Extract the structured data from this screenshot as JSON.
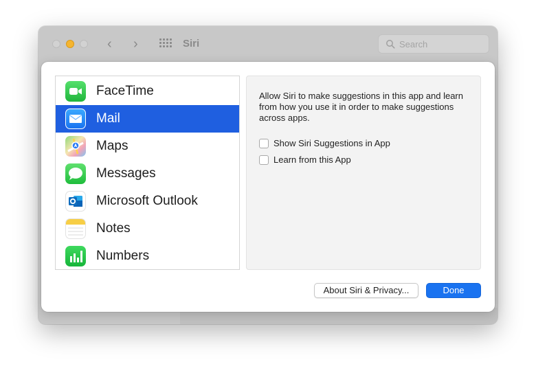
{
  "window": {
    "title": "Siri",
    "search_placeholder": "Search"
  },
  "apps": [
    {
      "label": "FaceTime",
      "icon": "facetime-icon",
      "selected": false
    },
    {
      "label": "Mail",
      "icon": "mail-icon",
      "selected": true
    },
    {
      "label": "Maps",
      "icon": "maps-icon",
      "selected": false
    },
    {
      "label": "Messages",
      "icon": "messages-icon",
      "selected": false
    },
    {
      "label": "Microsoft Outlook",
      "icon": "outlook-icon",
      "selected": false
    },
    {
      "label": "Notes",
      "icon": "notes-icon",
      "selected": false
    },
    {
      "label": "Numbers",
      "icon": "numbers-icon",
      "selected": false
    }
  ],
  "detail": {
    "description": "Allow Siri to make suggestions in this app and learn from how you use it in order to make suggestions across apps.",
    "options": [
      {
        "label": "Show Siri Suggestions in App",
        "checked": false
      },
      {
        "label": "Learn from this App",
        "checked": false
      }
    ]
  },
  "buttons": {
    "about": "About Siri & Privacy...",
    "done": "Done"
  },
  "colors": {
    "selection": "#1f5fe0",
    "accent": "#1a73f0",
    "minimize": "#f5b530"
  }
}
